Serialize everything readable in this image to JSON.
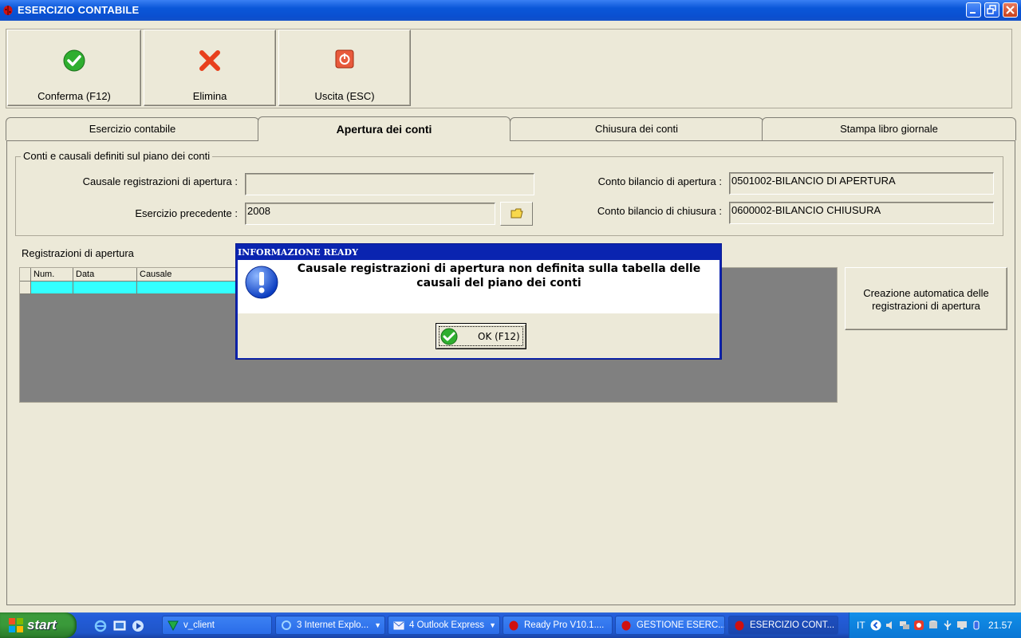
{
  "window": {
    "title": "ESERCIZIO CONTABILE"
  },
  "toolbar": {
    "confirm_label": "Conferma (F12)",
    "delete_label": "Elimina",
    "exit_label": "Uscita (ESC)"
  },
  "tabs": [
    {
      "label": "Esercizio contabile",
      "active": false
    },
    {
      "label": "Apertura dei conti",
      "active": true
    },
    {
      "label": "Chiusura dei conti",
      "active": false
    },
    {
      "label": "Stampa libro giornale",
      "active": false
    }
  ],
  "group": {
    "title": "Conti e causali definiti sul piano dei conti",
    "causale_label": "Causale registrazioni di apertura :",
    "causale_value": "",
    "esercizio_label": "Esercizio precedente :",
    "esercizio_value": "2008",
    "conto_apertura_label": "Conto bilancio di apertura :",
    "conto_apertura_value": "0501002-BILANCIO DI APERTURA",
    "conto_chiusura_label": "Conto bilancio di chiusura :",
    "conto_chiusura_value": "0600002-BILANCIO CHIUSURA"
  },
  "registrations": {
    "title": "Registrazioni di apertura",
    "columns": [
      "Num.",
      "Data",
      "Causale"
    ],
    "auto_button_label": "Creazione automatica delle registrazioni di apertura"
  },
  "dialog": {
    "title": "INFORMAZIONE READY",
    "message": "Causale registrazioni di apertura non definita sulla tabella delle causali del piano dei conti",
    "ok_label": "OK (F12)"
  },
  "taskbar": {
    "start_label": "start",
    "tasks": [
      {
        "label": "v_client"
      },
      {
        "label": "3 Internet Explo..."
      },
      {
        "label": "4 Outlook Express"
      },
      {
        "label": "Ready Pro V10.1...."
      },
      {
        "label": "GESTIONE ESERC..."
      },
      {
        "label": "ESERCIZIO CONT..."
      }
    ],
    "language": "IT",
    "clock": "21.57"
  },
  "colors": {
    "grid_selected_row": "#33ffff",
    "dialog_frame": "#0a24b0"
  }
}
